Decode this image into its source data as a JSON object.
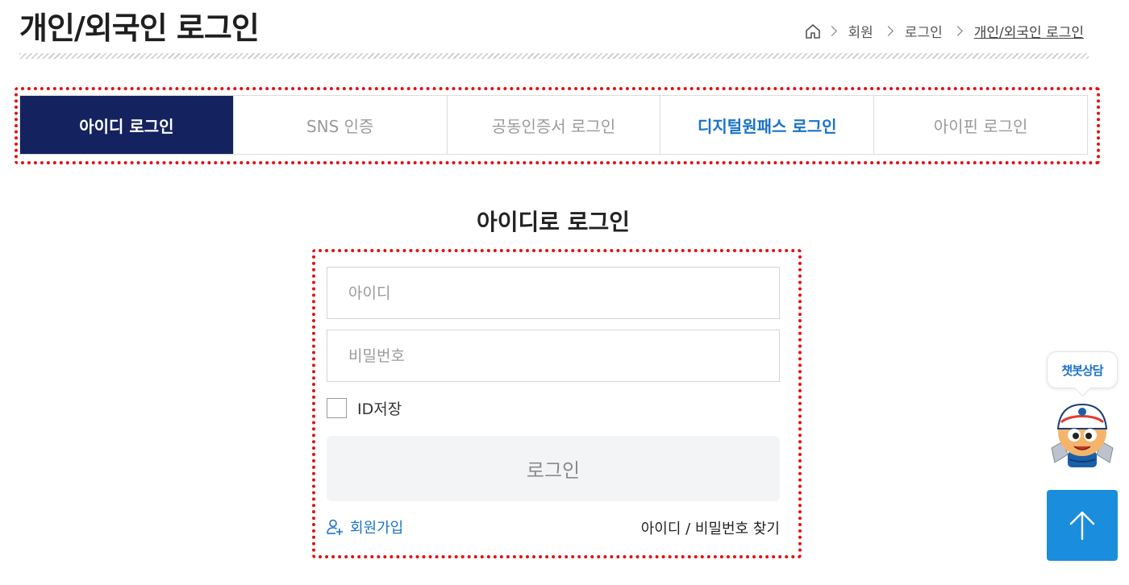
{
  "header": {
    "title": "개인/외국인 로그인",
    "breadcrumb": [
      "회원",
      "로그인",
      "개인/외국인 로그인"
    ]
  },
  "tabs": [
    {
      "label": "아이디 로그인",
      "state": "active"
    },
    {
      "label": "SNS 인증",
      "state": "normal"
    },
    {
      "label": "공동인증서 로그인",
      "state": "normal"
    },
    {
      "label": "디지털원패스 로그인",
      "state": "highlight"
    },
    {
      "label": "아이핀 로그인",
      "state": "normal"
    }
  ],
  "login": {
    "heading": "아이디로 로그인",
    "id_placeholder": "아이디",
    "pw_placeholder": "비밀번호",
    "save_label": "ID저장",
    "save_checked": false,
    "button_label": "로그인",
    "join_label": "회원가입",
    "find_label": "아이디 / 비밀번호 찾기"
  },
  "floating": {
    "chatbot_label": "챗봇상담"
  },
  "colors": {
    "active_tab": "#14235f",
    "accent": "#1a72c9",
    "highlight_outline": "#e31010",
    "top_button": "#1a8ddc"
  }
}
